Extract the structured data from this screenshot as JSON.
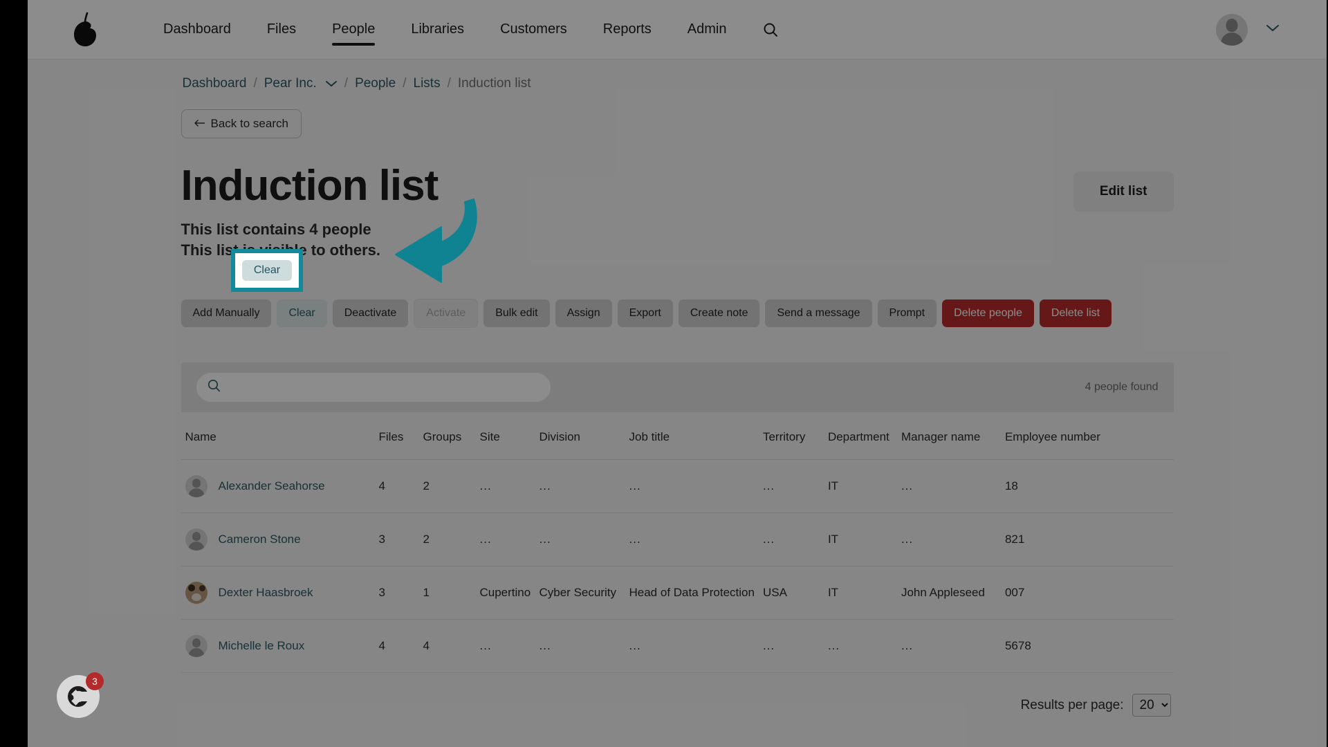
{
  "nav": {
    "logo_icon": "pear-logo-icon",
    "items": [
      {
        "label": "Dashboard",
        "active": false
      },
      {
        "label": "Files",
        "active": false
      },
      {
        "label": "People",
        "active": true
      },
      {
        "label": "Libraries",
        "active": false
      },
      {
        "label": "Customers",
        "active": false
      },
      {
        "label": "Reports",
        "active": false
      },
      {
        "label": "Admin",
        "active": false
      }
    ],
    "search_icon": "search-icon",
    "user_chevron_icon": "chevron-down-icon",
    "avatar_icon": "user-avatar-icon"
  },
  "breadcrumb": {
    "items": [
      {
        "label": "Dashboard",
        "type": "link"
      },
      {
        "label": "/",
        "type": "sep"
      },
      {
        "label": "Pear Inc.",
        "type": "link-dropdown"
      },
      {
        "label": "/",
        "type": "sep"
      },
      {
        "label": "People",
        "type": "link"
      },
      {
        "label": "/",
        "type": "sep"
      },
      {
        "label": "Lists",
        "type": "link"
      },
      {
        "label": "/",
        "type": "sep"
      },
      {
        "label": "Induction list",
        "type": "current"
      }
    ],
    "org_chevron_icon": "chevron-down-icon"
  },
  "back_button": {
    "label": "Back to search",
    "arrow_icon": "arrow-left-icon"
  },
  "header": {
    "title": "Induction list",
    "subtitle_line1": "This list contains 4 people",
    "subtitle_line2": "This list is visible to others.",
    "edit_button_label": "Edit list"
  },
  "actions": [
    {
      "label": "Add Manually",
      "style": "default"
    },
    {
      "label": "Clear",
      "style": "clear"
    },
    {
      "label": "Deactivate",
      "style": "default"
    },
    {
      "label": "Activate",
      "style": "disabled"
    },
    {
      "label": "Bulk edit",
      "style": "default"
    },
    {
      "label": "Assign",
      "style": "default"
    },
    {
      "label": "Export",
      "style": "default"
    },
    {
      "label": "Create note",
      "style": "default"
    },
    {
      "label": "Send a message",
      "style": "default"
    },
    {
      "label": "Prompt",
      "style": "default"
    },
    {
      "label": "Delete people",
      "style": "danger"
    },
    {
      "label": "Delete list",
      "style": "danger"
    }
  ],
  "search": {
    "value": "",
    "placeholder": "",
    "icon": "search-icon",
    "results_text": "4 people found"
  },
  "table": {
    "columns": [
      "Name",
      "Files",
      "Groups",
      "Site",
      "Division",
      "Job title",
      "Territory",
      "Department",
      "Manager name",
      "Employee number"
    ],
    "rows": [
      {
        "avatar": "default",
        "name": "Alexander Seahorse",
        "files": "4",
        "groups": "2",
        "site": "...",
        "division": "...",
        "job_title": "...",
        "territory": "...",
        "department": "IT",
        "manager_name": "...",
        "employee_number": "18"
      },
      {
        "avatar": "default",
        "name": "Cameron Stone",
        "files": "3",
        "groups": "2",
        "site": "...",
        "division": "...",
        "job_title": "...",
        "territory": "...",
        "department": "IT",
        "manager_name": "...",
        "employee_number": "821"
      },
      {
        "avatar": "photo",
        "name": "Dexter Haasbroek",
        "files": "3",
        "groups": "1",
        "site": "Cupertino",
        "division": "Cyber Security",
        "job_title": "Head of Data Protection",
        "territory": "USA",
        "department": "IT",
        "manager_name": "John Appleseed",
        "employee_number": "007"
      },
      {
        "avatar": "default",
        "name": "Michelle le Roux",
        "files": "4",
        "groups": "4",
        "site": "...",
        "division": "...",
        "job_title": "...",
        "territory": "...",
        "department": "...",
        "manager_name": "...",
        "employee_number": "5678"
      }
    ]
  },
  "footer": {
    "results_per_page_label": "Results per page:",
    "results_per_page_value": "20",
    "results_per_page_options": [
      "20"
    ]
  },
  "chat_widget": {
    "icon": "chat-logo-icon",
    "badge_count": "3"
  },
  "annotation": {
    "highlighted_element_label": "Clear",
    "arrow_icon": "arrow-pointer-icon",
    "accent_color": "#128a99"
  },
  "colors": {
    "link": "#2c5963",
    "danger": "#bb2d2d",
    "accent": "#128a99",
    "page_bg": "#f5f5f5"
  }
}
